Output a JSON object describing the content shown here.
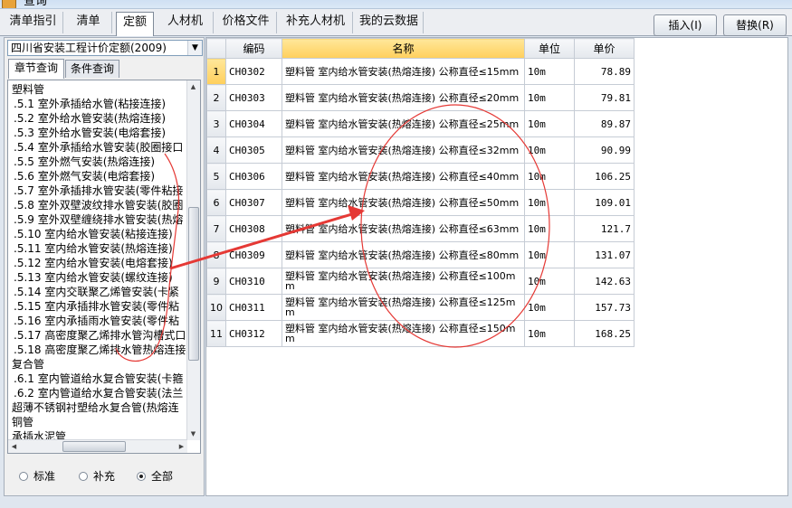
{
  "window": {
    "title": "查询"
  },
  "tabs": [
    {
      "label": "清单指引",
      "active": false
    },
    {
      "label": "清单",
      "active": false
    },
    {
      "label": "定额",
      "active": true
    },
    {
      "label": "人材机",
      "active": false
    },
    {
      "label": "价格文件",
      "active": false
    },
    {
      "label": "补充人材机",
      "active": false
    },
    {
      "label": "我的云数据",
      "active": false
    }
  ],
  "actions": {
    "insert": "插入(I)",
    "replace": "替换(R)"
  },
  "left": {
    "library": "四川省安装工程计价定额(2009)",
    "subtabs": [
      {
        "label": "章节查询",
        "active": true
      },
      {
        "label": "条件查询",
        "active": false
      }
    ],
    "tree": [
      "塑料管",
      ".5.1 室外承插给水管(粘接连接)",
      ".5.2 室外给水管安装(热熔连接)",
      ".5.3 室外给水管安装(电熔套接)",
      ".5.4 室外承插给水管安装(胶圈接口",
      ".5.5 室外燃气安装(热熔连接)",
      ".5.6 室外燃气安装(电熔套接)",
      ".5.7 室外承插排水管安装(零件粘接",
      ".5.8 室外双壁波纹排水管安装(胶圈",
      ".5.9 室外双壁缠绕排水管安装(热熔",
      ".5.10 室内给水管安装(粘接连接)",
      ".5.11 室内给水管安装(热熔连接)",
      ".5.12 室内给水管安装(电熔套接)",
      ".5.13 室内给水管安装(螺纹连接)",
      ".5.14 室内交联聚乙烯管安装(卡紧",
      ".5.15 室内承插排水管安装(零件粘",
      ".5.16 室内承插雨水管安装(零件粘",
      ".5.17 高密度聚乙烯排水管沟槽式口",
      ".5.18 高密度聚乙烯排水管热熔连接",
      "复合管",
      ".6.1 室内管道给水复合管安装(卡箍",
      ".6.2 室内管道给水复合管安装(法兰",
      "超薄不锈钢衬塑给水复合管(热熔连",
      "铜管",
      "承插水泥管"
    ],
    "radios": [
      {
        "label": "标准",
        "checked": false
      },
      {
        "label": "补充",
        "checked": false
      },
      {
        "label": "全部",
        "checked": true
      }
    ]
  },
  "grid": {
    "headers": {
      "code": "编码",
      "name": "名称",
      "unit": "单位",
      "price": "单价"
    },
    "rows": [
      {
        "num": "1",
        "code": "CH0302",
        "name": "塑料管 室内给水管安装(热熔连接) 公称直径≤15mm",
        "unit": "10m",
        "price": "78.89"
      },
      {
        "num": "2",
        "code": "CH0303",
        "name": "塑料管 室内给水管安装(热熔连接) 公称直径≤20mm",
        "unit": "10m",
        "price": "79.81"
      },
      {
        "num": "3",
        "code": "CH0304",
        "name": "塑料管 室内给水管安装(热熔连接) 公称直径≤25mm",
        "unit": "10m",
        "price": "89.87"
      },
      {
        "num": "4",
        "code": "CH0305",
        "name": "塑料管 室内给水管安装(热熔连接) 公称直径≤32mm",
        "unit": "10m",
        "price": "90.99"
      },
      {
        "num": "5",
        "code": "CH0306",
        "name": "塑料管 室内给水管安装(热熔连接) 公称直径≤40mm",
        "unit": "10m",
        "price": "106.25"
      },
      {
        "num": "6",
        "code": "CH0307",
        "name": "塑料管 室内给水管安装(热熔连接) 公称直径≤50mm",
        "unit": "10m",
        "price": "109.01"
      },
      {
        "num": "7",
        "code": "CH0308",
        "name": "塑料管 室内给水管安装(热熔连接) 公称直径≤63mm",
        "unit": "10m",
        "price": "121.7"
      },
      {
        "num": "8",
        "code": "CH0309",
        "name": "塑料管 室内给水管安装(热熔连接) 公称直径≤80mm",
        "unit": "10m",
        "price": "131.07"
      },
      {
        "num": "9",
        "code": "CH0310",
        "name": "塑料管 室内给水管安装(热熔连接) 公称直径≤100mm",
        "unit": "10m",
        "price": "142.63"
      },
      {
        "num": "10",
        "code": "CH0311",
        "name": "塑料管 室内给水管安装(热熔连接) 公称直径≤125mm",
        "unit": "10m",
        "price": "157.73"
      },
      {
        "num": "11",
        "code": "CH0312",
        "name": "塑料管 室内给水管安装(热熔连接) 公称直径≤150mm",
        "unit": "10m",
        "price": "168.25"
      }
    ]
  },
  "annotation_color": "#e53935"
}
